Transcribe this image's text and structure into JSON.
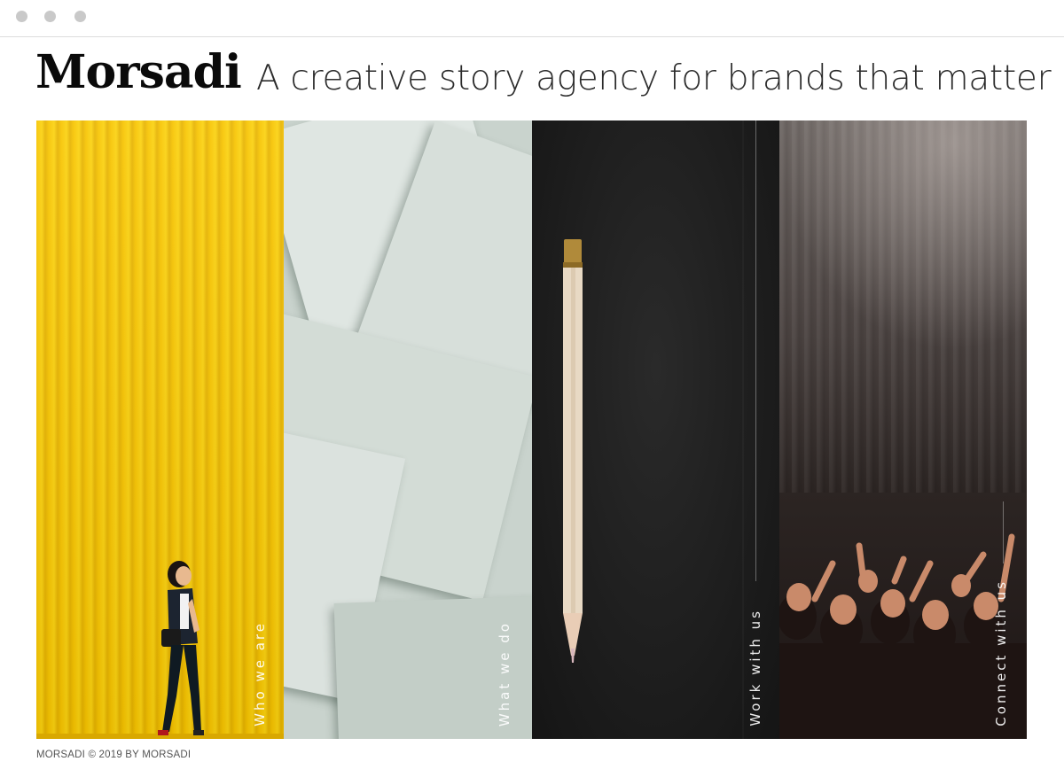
{
  "brand": {
    "logo": "Morsadi"
  },
  "header": {
    "tagline": "A creative story agency for brands that matter"
  },
  "panels": [
    {
      "label": "Who we are",
      "icon": "woman-walking-yellow-wall-photo"
    },
    {
      "label": "What we do",
      "icon": "scattered-paper-sheets-photo"
    },
    {
      "label": "Work with us",
      "icon": "pencil-on-black-photo"
    },
    {
      "label": "Connect with us",
      "icon": "concert-crowd-photo"
    }
  ],
  "footer": {
    "copyright": "MORSADI © 2019 BY MORSADI"
  },
  "colors": {
    "yellow": "#f7c400",
    "paper": "#dfe6e2",
    "dark": "#1b1b1b",
    "concert": "#2c2523"
  }
}
